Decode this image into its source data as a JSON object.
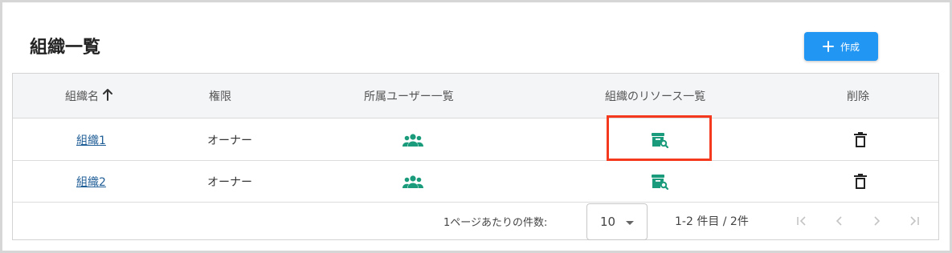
{
  "page": {
    "title": "組織一覧",
    "create_button": {
      "label": "作成",
      "icon": "plus-icon"
    }
  },
  "table": {
    "columns": [
      {
        "label": "組織名",
        "sort": "ascending",
        "sort_icon": "arrow-up-icon"
      },
      {
        "label": "権限"
      },
      {
        "label": "所属ユーザー一覧"
      },
      {
        "label": "組織のリソース一覧"
      },
      {
        "label": "削除"
      }
    ],
    "rows": [
      {
        "name": "組織1",
        "role": "オーナー",
        "users_icon": "group-icon",
        "resources_icon": "archive-search-icon",
        "delete_icon": "trash-icon"
      },
      {
        "name": "組織2",
        "role": "オーナー",
        "users_icon": "group-icon",
        "resources_icon": "archive-search-icon",
        "delete_icon": "trash-icon"
      }
    ]
  },
  "pagination": {
    "rows_per_page_label": "1ページあたりの件数:",
    "rows_per_page_value": "10",
    "range_text": "1-2 件目 / 2件",
    "nav_icons": [
      "first-page-icon",
      "prev-page-icon",
      "next-page-icon",
      "last-page-icon"
    ]
  },
  "colors": {
    "accent": "#2196f3",
    "icon_teal": "#1a9b7b",
    "link": "#1f5d96",
    "highlight": "#f4391f",
    "header_bg": "#f4f5f7"
  }
}
